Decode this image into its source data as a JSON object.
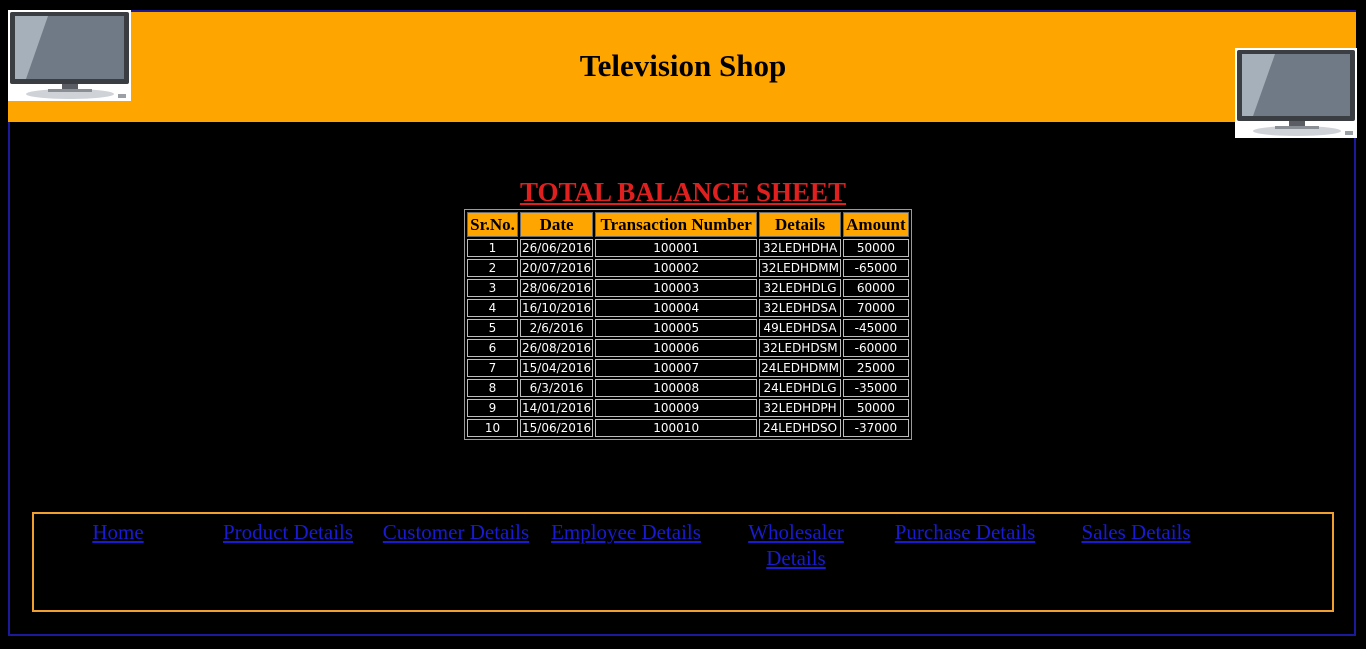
{
  "header": {
    "title": "Television Shop"
  },
  "colors": {
    "header_bg": "#ffa500",
    "page_bg": "#000000",
    "sheet_title": "#e0201e",
    "nav_link": "#1a1ad0",
    "nav_border": "#f0a030",
    "frame_border": "#1a1a9a"
  },
  "images": {
    "left": "television-icon",
    "right": "television-icon"
  },
  "sheet": {
    "title": "TOTAL BALANCE SHEET",
    "columns": [
      "Sr.No.",
      "Date",
      "Transaction Number",
      "Details",
      "Amount"
    ],
    "rows": [
      [
        "1",
        "26/06/2016",
        "100001",
        "32LEDHDHA",
        "50000"
      ],
      [
        "2",
        "20/07/2016",
        "100002",
        "32LEDHDMM",
        "-65000"
      ],
      [
        "3",
        "28/06/2016",
        "100003",
        "32LEDHDLG",
        "60000"
      ],
      [
        "4",
        "16/10/2016",
        "100004",
        "32LEDHDSA",
        "70000"
      ],
      [
        "5",
        "2/6/2016",
        "100005",
        "49LEDHDSA",
        "-45000"
      ],
      [
        "6",
        "26/08/2016",
        "100006",
        "32LEDHDSM",
        "-60000"
      ],
      [
        "7",
        "15/04/2016",
        "100007",
        "24LEDHDMM",
        "25000"
      ],
      [
        "8",
        "6/3/2016",
        "100008",
        "24LEDHDLG",
        "-35000"
      ],
      [
        "9",
        "14/01/2016",
        "100009",
        "32LEDHDPH",
        "50000"
      ],
      [
        "10",
        "15/06/2016",
        "100010",
        "24LEDHDSO",
        "-37000"
      ]
    ]
  },
  "nav": {
    "home": "Home",
    "product_details": "Product Details",
    "customer_details": "Customer Details",
    "employee_details": "Employee Details",
    "wholesaler_details": "Wholesaler Details",
    "purchase_details": "Purchase Details",
    "sales_details": "Sales Details"
  }
}
